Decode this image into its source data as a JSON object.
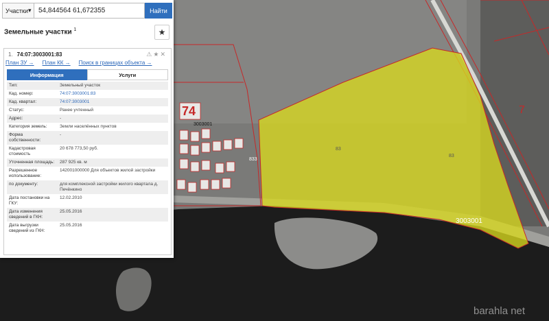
{
  "search": {
    "scope": "Участки",
    "query": "54,844564 61,672355",
    "button": "Найти"
  },
  "panel": {
    "title": "Земельные участки",
    "title_count": "1"
  },
  "result": {
    "index": "1.",
    "cad_number": "74:07:3003001:83",
    "links": [
      "План ЗУ →",
      "План КК →",
      "Поиск в границах объекта →"
    ],
    "tabs": [
      "Информация",
      "Услуги"
    ],
    "rows": [
      {
        "k": "Тип:",
        "v": "Земельный участок"
      },
      {
        "k": "Кад. номер:",
        "v": "74:07:3003001:83",
        "link": true
      },
      {
        "k": "Кад. квартал:",
        "v": "74:07:3003001",
        "link": true
      },
      {
        "k": "Статус:",
        "v": "Ранее учтенный"
      },
      {
        "k": "Адрес:",
        "v": "-"
      },
      {
        "k": "Категория земель:",
        "v": "Земли населённых пунктов"
      },
      {
        "k": "Форма собственности:",
        "v": "-"
      },
      {
        "k": "Кадастровая стоимость",
        "v": "20 678 773,50 руб."
      },
      {
        "k": "Уточненная площадь:",
        "v": "287 925 кв. м"
      },
      {
        "k": "Разрешенное использование:",
        "v": "142001000000 Для объектов жилой застройки"
      },
      {
        "k": "по документу:",
        "v": "для комплексной застройки жилого квартала д. Печёнкино"
      },
      {
        "k": "Дата постановки на ГКУ:",
        "v": "12.02.2010"
      },
      {
        "k": "Дата изменения сведений в ГКН:",
        "v": "25.05.2016"
      },
      {
        "k": "Дата выгрузки сведений из ГКН:",
        "v": "25.05.2016"
      }
    ]
  },
  "map": {
    "labels": {
      "district_74": "74",
      "block_3003001": "3003001",
      "block_3003001_small": "3003001",
      "parcel_83_a": "83",
      "parcel_83_b": "83",
      "parcel_833": "833",
      "zone_7": "7"
    },
    "watermark": "barahla net",
    "colors": {
      "parcel_fill": "#d9d91e",
      "boundary": "#c62828",
      "water": "#1c1c1c"
    }
  }
}
